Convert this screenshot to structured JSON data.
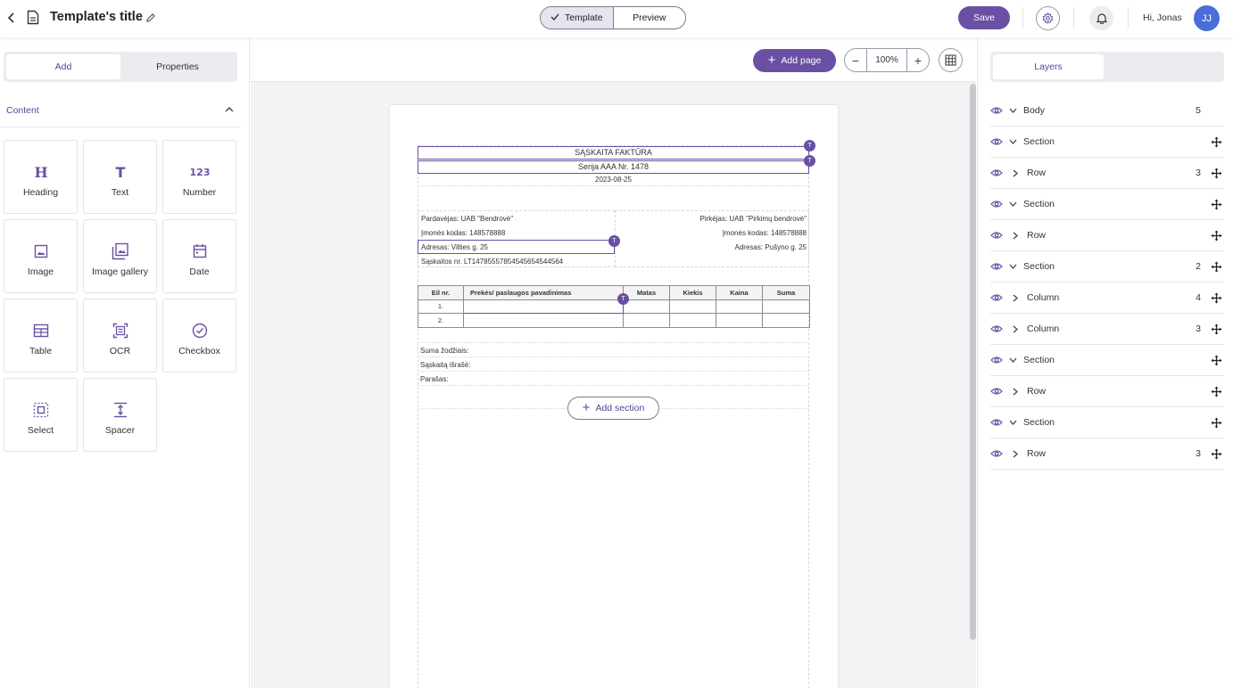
{
  "header": {
    "title": "Template's title",
    "mode_template": "Template",
    "mode_preview": "Preview",
    "save_label": "Save",
    "greeting": "Hi, Jonas",
    "avatar_initials": "JJ"
  },
  "left": {
    "tab_add": "Add",
    "tab_properties": "Properties",
    "section_title": "Content",
    "tiles": [
      {
        "label": "Heading",
        "icon": "heading-icon"
      },
      {
        "label": "Text",
        "icon": "text-icon"
      },
      {
        "label": "Number",
        "icon": "number-icon"
      },
      {
        "label": "Image",
        "icon": "image-icon"
      },
      {
        "label": "Image gallery",
        "icon": "image-gallery-icon"
      },
      {
        "label": "Date",
        "icon": "calendar-icon"
      },
      {
        "label": "Table",
        "icon": "table-icon"
      },
      {
        "label": "OCR",
        "icon": "ocr-icon"
      },
      {
        "label": "Checkbox",
        "icon": "checkbox-icon"
      },
      {
        "label": "Select",
        "icon": "select-icon"
      },
      {
        "label": "Spacer",
        "icon": "spacer-icon"
      }
    ]
  },
  "canvas": {
    "add_page": "Add page",
    "zoom": "100%",
    "add_section": "Add section"
  },
  "doc": {
    "title": "SĄSKAITA FAKTŪRA",
    "series": "Serija AAA Nr. 1478",
    "date": "2023-08-25",
    "seller_name": "Pardavėjas: UAB \"Bendrovė\"",
    "seller_code": "Įmonės kodas: 148578888",
    "seller_address": "Adresas: Vilties g. 25",
    "seller_account": "Sąskaitos nr. LT1478555785454565454456​4",
    "buyer_name": "Pirkėjas: UAB \"Pirkimų bendrovė\"",
    "buyer_code": "Įmonės kodas: 148578888",
    "buyer_address": "Adresas: Pušyno g. 25",
    "table_headers": [
      "Eil nr.",
      "Prekės/ paslaugos pavadinimas",
      "Matas",
      "Kiekis",
      "Kaina",
      "Suma"
    ],
    "rows": [
      "1.",
      "2."
    ],
    "sum_words": "Suma žodžiais:",
    "issued_by": "Sąskaitą išrašė:",
    "signature": "Parašas:",
    "badge": "T"
  },
  "layers": {
    "tab": "Layers",
    "items": [
      {
        "name": "Body",
        "count": "5",
        "expanded": true,
        "indent": 0,
        "move": false
      },
      {
        "name": "Section",
        "count": "",
        "expanded": true,
        "indent": 0,
        "move": true
      },
      {
        "name": "Row",
        "count": "3",
        "expanded": false,
        "indent": 1,
        "move": true
      },
      {
        "name": "Section",
        "count": "",
        "expanded": true,
        "indent": 0,
        "move": true
      },
      {
        "name": "Row",
        "count": "",
        "expanded": false,
        "indent": 1,
        "move": true
      },
      {
        "name": "Section",
        "count": "2",
        "expanded": true,
        "indent": 0,
        "move": true
      },
      {
        "name": "Column",
        "count": "4",
        "expanded": false,
        "indent": 1,
        "move": true
      },
      {
        "name": "Column",
        "count": "3",
        "expanded": false,
        "indent": 1,
        "move": true
      },
      {
        "name": "Section",
        "count": "",
        "expanded": true,
        "indent": 0,
        "move": true
      },
      {
        "name": "Row",
        "count": "",
        "expanded": false,
        "indent": 1,
        "move": true
      },
      {
        "name": "Section",
        "count": "",
        "expanded": true,
        "indent": 0,
        "move": true
      },
      {
        "name": "Row",
        "count": "3",
        "expanded": false,
        "indent": 1,
        "move": true
      }
    ]
  },
  "colors": {
    "accent": "#6a4fa5",
    "avatar": "#4a6ed8"
  }
}
